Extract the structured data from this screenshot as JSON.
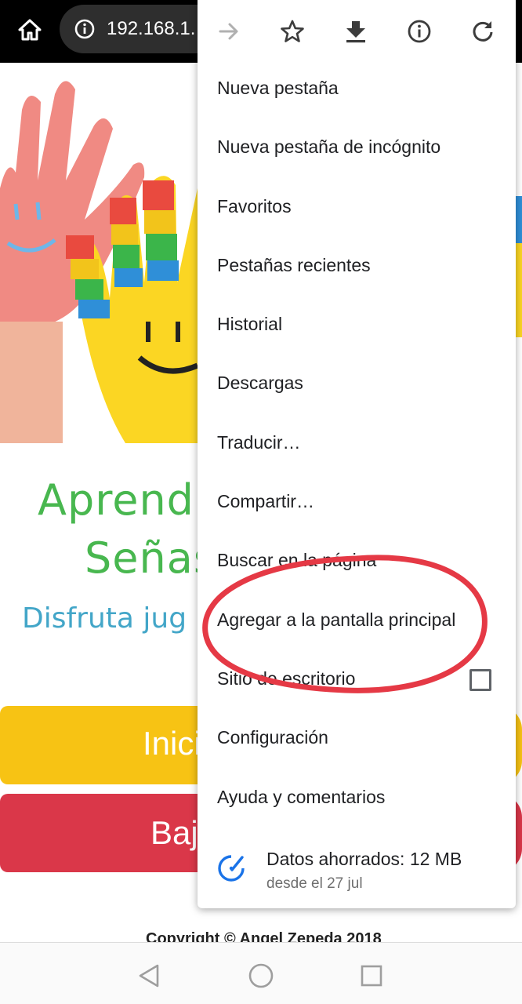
{
  "browser": {
    "url": "192.168.1."
  },
  "page": {
    "title_line1": "Aprend",
    "title_line2": "Señas",
    "subtitle": "Disfruta jug",
    "button_start": "Inici",
    "button_download": "Baja",
    "copyright": "Copyright © Angel Zepeda 2018"
  },
  "menu": {
    "toolbar": [
      "forward-icon",
      "star-icon",
      "download-icon",
      "info-icon",
      "reload-icon"
    ],
    "items": [
      {
        "label": "Nueva pestaña"
      },
      {
        "label": "Nueva pestaña de incógnito"
      },
      {
        "label": "Favoritos"
      },
      {
        "label": "Pestañas recientes"
      },
      {
        "label": "Historial"
      },
      {
        "label": "Descargas"
      },
      {
        "label": "Traducir…"
      },
      {
        "label": "Compartir…"
      },
      {
        "label": "Buscar en la página"
      },
      {
        "label": "Agregar a la pantalla principal"
      },
      {
        "label": "Sitio de escritorio",
        "checked": false
      },
      {
        "label": "Configuración"
      },
      {
        "label": "Ayuda y comentarios"
      }
    ],
    "data_saved": {
      "label": "Datos ahorrados: 12 MB",
      "sublabel": "desde el 27 jul"
    }
  },
  "colors": {
    "accent_blue": "#1a73e8",
    "annotation_red": "#e53945",
    "title_green": "#48b74f",
    "subtitle_blue": "#43a6c8",
    "button_yellow": "#f7c314",
    "button_red": "#da3749"
  }
}
